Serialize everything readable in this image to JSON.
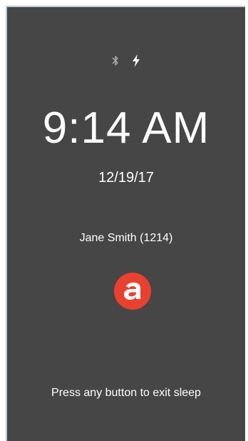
{
  "status_bar": {
    "icons": [
      "bluetooth-icon",
      "charging-icon"
    ]
  },
  "lock_screen": {
    "time": "9:14 AM",
    "date": "12/19/17",
    "user": "Jane Smith (1214)",
    "hint": "Press any button to exit sleep"
  },
  "colors": {
    "background": "#464646",
    "logo_red": "#e8412f",
    "text": "#ffffff"
  }
}
